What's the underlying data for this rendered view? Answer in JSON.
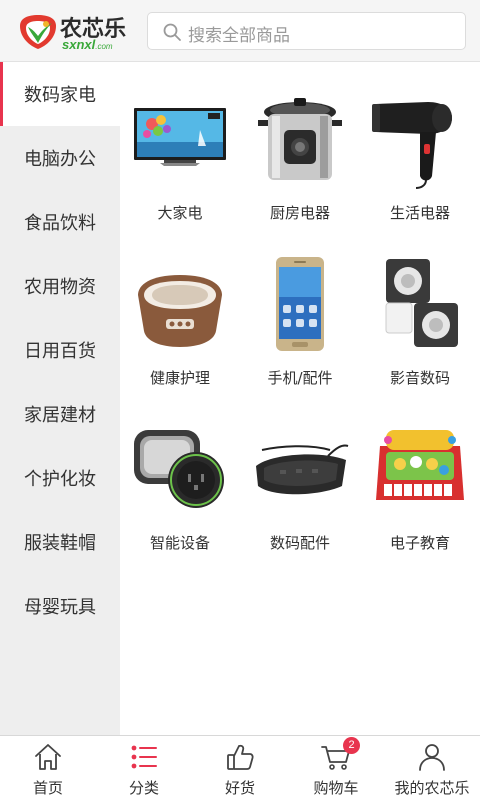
{
  "header": {
    "logo_cn": "农芯乐",
    "logo_en": "sxnxl",
    "logo_en_suffix": ".com",
    "search_placeholder": "搜索全部商品"
  },
  "sidebar": {
    "active_index": 0,
    "accent_color": "#e8344e",
    "items": [
      {
        "label": "数码家电"
      },
      {
        "label": "电脑办公"
      },
      {
        "label": "食品饮料"
      },
      {
        "label": "农用物资"
      },
      {
        "label": "日用百货"
      },
      {
        "label": "家居建材"
      },
      {
        "label": "个护化妆"
      },
      {
        "label": "服装鞋帽"
      },
      {
        "label": "母婴玩具"
      }
    ]
  },
  "products": [
    {
      "label": "大家电",
      "icon": "tv-icon"
    },
    {
      "label": "厨房电器",
      "icon": "pressure-cooker-icon"
    },
    {
      "label": "生活电器",
      "icon": "hair-dryer-icon"
    },
    {
      "label": "健康护理",
      "icon": "foot-spa-icon"
    },
    {
      "label": "手机/配件",
      "icon": "smartphone-icon"
    },
    {
      "label": "影音数码",
      "icon": "speakers-icon"
    },
    {
      "label": "智能设备",
      "icon": "smart-plug-icon"
    },
    {
      "label": "数码配件",
      "icon": "power-strip-icon"
    },
    {
      "label": "电子教育",
      "icon": "kids-keyboard-icon"
    }
  ],
  "tabbar": {
    "active_index": 1,
    "items": [
      {
        "label": "首页",
        "icon": "home-icon"
      },
      {
        "label": "分类",
        "icon": "category-list-icon"
      },
      {
        "label": "好货",
        "icon": "thumbs-up-icon"
      },
      {
        "label": "购物车",
        "icon": "cart-icon",
        "badge": "2"
      },
      {
        "label": "我的农芯乐",
        "icon": "user-icon"
      }
    ]
  }
}
